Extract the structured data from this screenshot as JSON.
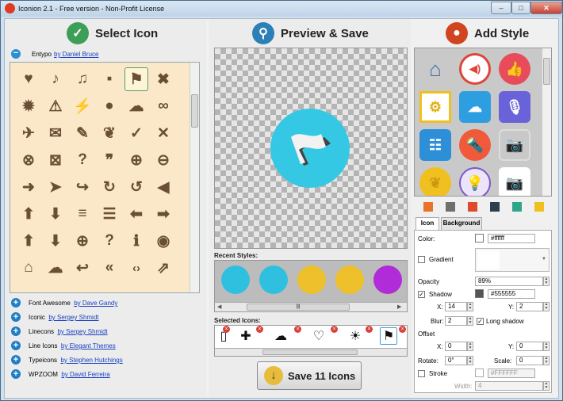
{
  "window": {
    "title": "Iconion 2.1 - Free version - Non-Profit License",
    "minimize": "–",
    "maximize": "□",
    "close": "✕"
  },
  "left": {
    "header": "Select Icon",
    "entypo": {
      "name": "Entypo",
      "author": "by Daniel Bruce"
    },
    "icons": [
      "♥",
      "♪",
      "♫",
      "▪",
      "⚑",
      "✖",
      "✹",
      "⚠",
      "⚡",
      "●",
      "☁",
      "∞",
      "✈",
      "✉",
      "✎",
      "❦",
      "✓",
      "✕",
      "⊗",
      "⊠",
      "?",
      "❞",
      "⊕",
      "⊖",
      "➜",
      "➤",
      "↪",
      "↻",
      "↺",
      "◀",
      "⬆",
      "⬇",
      "≡",
      "☰",
      "⬅",
      "➡",
      "⬆",
      "⬇",
      "⊕",
      "?",
      "ℹ",
      "◉",
      "⌂",
      "☁",
      "↩",
      "«",
      "‹›",
      "⇗"
    ],
    "libraries": [
      {
        "name": "Font Awesome",
        "author": "by Dave Gandy"
      },
      {
        "name": "Iconic",
        "author": "by Sergey Shmidt"
      },
      {
        "name": "Linecons",
        "author": "by Sergey Shmidt"
      },
      {
        "name": "Line Icons",
        "author": "by Elegant Themes"
      },
      {
        "name": "Typeicons",
        "author": "by Stephen Hutchings"
      },
      {
        "name": "WPZOOM",
        "author": "by David Ferreira"
      }
    ]
  },
  "middle": {
    "header": "Preview & Save",
    "recent_label": "Recent Styles:",
    "selected_label": "Selected Icons:",
    "selected_icons": [
      "▯",
      "✚",
      "☁",
      "♡",
      "☀",
      "⚑"
    ],
    "save_label": "Save 11 Icons",
    "save_arrow": "↓",
    "scroll_grip": "|||",
    "arrow_left": "◀",
    "arrow_right": "▶"
  },
  "right": {
    "header": "Add Style",
    "styles": [
      "⌂",
      "◀)",
      "👍",
      "⚙",
      "☁",
      "🎙",
      "☷",
      "🔦",
      "📷",
      "❦",
      "💡",
      "📷"
    ],
    "swatches": [
      "#e8732a",
      "#6f6f6f",
      "#de4a2a",
      "#2f3e4f",
      "#2fa58a",
      "#f0c020"
    ],
    "tabs": {
      "icon": "Icon",
      "background": "Background"
    },
    "color": {
      "label": "Color:",
      "value": "#ffffff"
    },
    "gradient": {
      "label": "Gradient"
    },
    "opacity": {
      "label": "Opacity",
      "value": "89%"
    },
    "shadow": {
      "label": "Shadow",
      "checked": true,
      "color": "#555555",
      "color_value": "#555555",
      "x_label": "X:",
      "x": "14",
      "y_label": "Y:",
      "y": "2",
      "blur_label": "Blur:",
      "blur": "2"
    },
    "long_shadow": {
      "label": "Long shadow",
      "checked": true
    },
    "offset": {
      "label": "Offset",
      "x_label": "X:",
      "x": "0",
      "y_label": "Y:",
      "y": "0"
    },
    "rotate": {
      "label": "Rotate:",
      "value": "0°"
    },
    "scale": {
      "label": "Scale:",
      "value": "0"
    },
    "stroke": {
      "label": "Stroke",
      "color_value": "#FFFFFF",
      "width_label": "Width:",
      "width": "4"
    },
    "check": "✓"
  }
}
